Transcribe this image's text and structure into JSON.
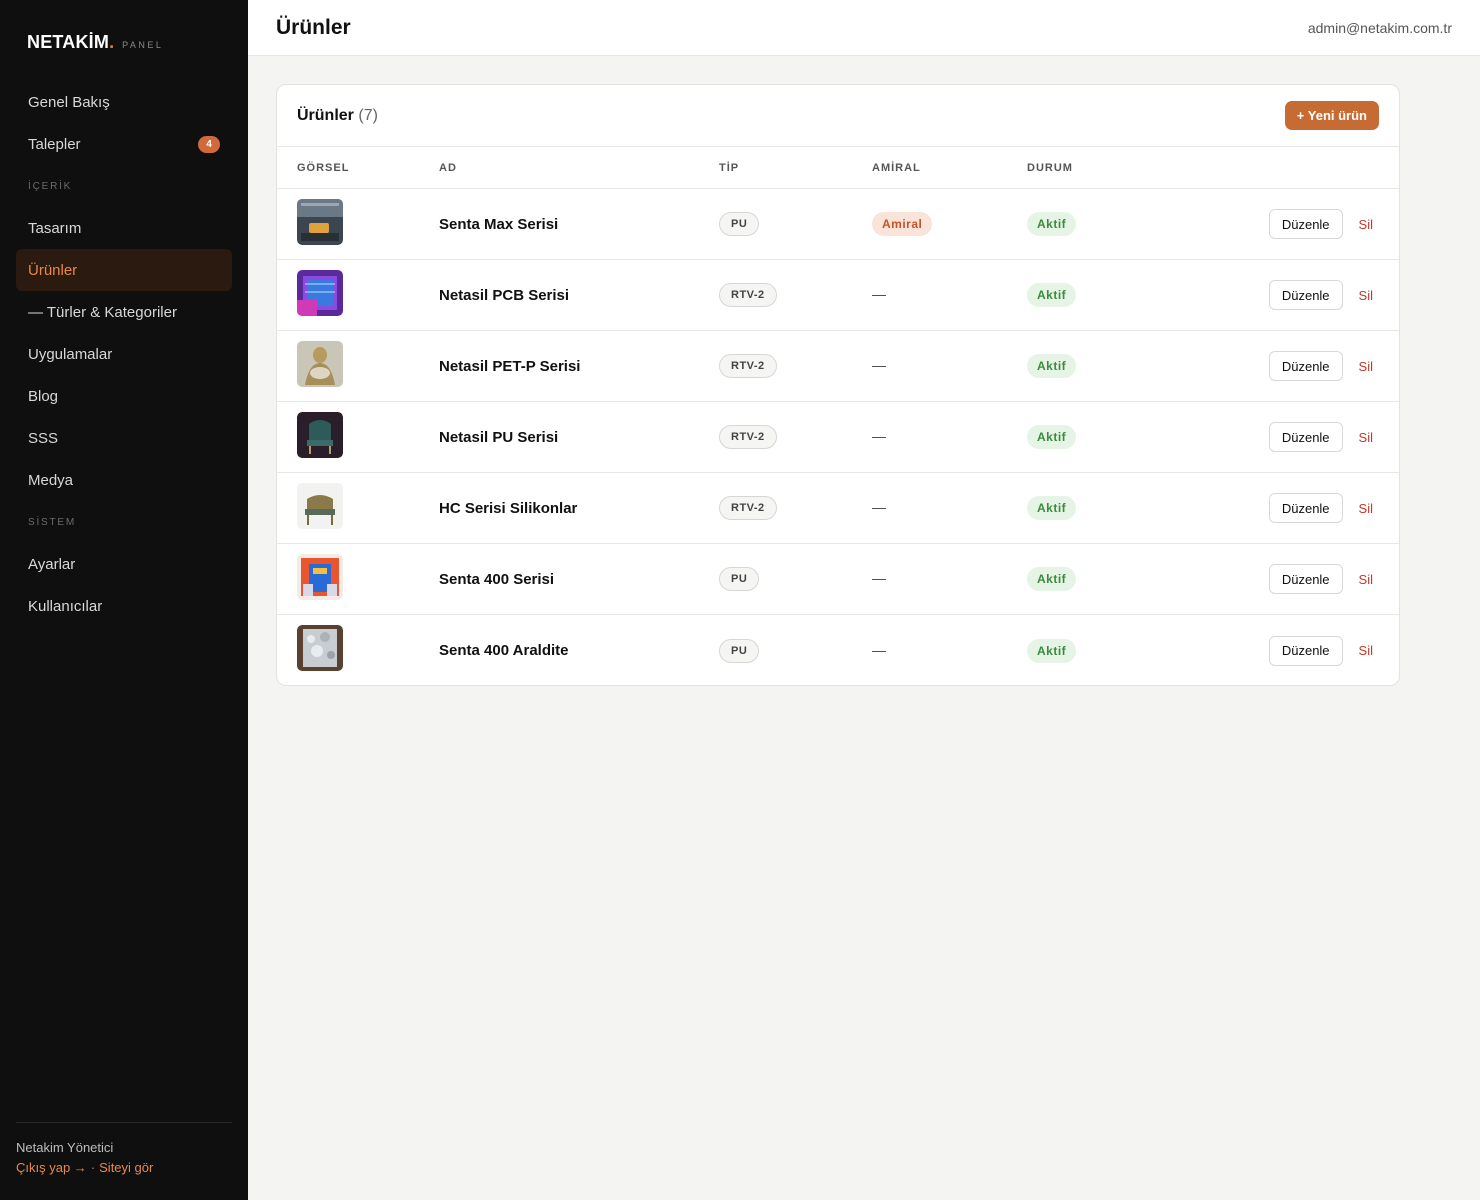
{
  "brand": {
    "name": "NETAKİM",
    "dot": ".",
    "panel": "PANEL"
  },
  "nav": {
    "genel": "Genel Bakış",
    "talepler": "Talepler",
    "talepler_badge": "4",
    "section_icerik": "İÇERİK",
    "tasarim": "Tasarım",
    "urunler": "Ürünler",
    "turler": "— Türler & Kategoriler",
    "uygulamalar": "Uygulamalar",
    "blog": "Blog",
    "sss": "SSS",
    "medya": "Medya",
    "section_sistem": "SİSTEM",
    "ayarlar": "Ayarlar",
    "kullanicilar": "Kullanıcılar"
  },
  "footer": {
    "user": "Netakim Yönetici",
    "logout": "Çıkış yap →",
    "separator": "·",
    "site": "Siteyi gör"
  },
  "header": {
    "title": "Ürünler",
    "email": "admin@netakim.com.tr"
  },
  "card": {
    "title": "Ürünler",
    "count": "(7)",
    "new_button": "+ Yeni ürün"
  },
  "columns": {
    "image": "GÖRSEL",
    "name": "AD",
    "type": "TİP",
    "flag": "AMİRAL",
    "status": "DURUM"
  },
  "actions": {
    "edit": "Düzenle",
    "delete": "Sil"
  },
  "products": [
    {
      "name": "Senta Max Serisi",
      "type": "PU",
      "flag": "Amiral",
      "status": "Aktif"
    },
    {
      "name": "Netasil PCB Serisi",
      "type": "RTV-2",
      "flag": "—",
      "status": "Aktif"
    },
    {
      "name": "Netasil PET-P Serisi",
      "type": "RTV-2",
      "flag": "—",
      "status": "Aktif"
    },
    {
      "name": "Netasil PU Serisi",
      "type": "RTV-2",
      "flag": "—",
      "status": "Aktif"
    },
    {
      "name": "HC Serisi Silikonlar",
      "type": "RTV-2",
      "flag": "—",
      "status": "Aktif"
    },
    {
      "name": "Senta 400 Serisi",
      "type": "PU",
      "flag": "—",
      "status": "Aktif"
    },
    {
      "name": "Senta 400 Araldite",
      "type": "PU",
      "flag": "—",
      "status": "Aktif"
    }
  ],
  "colors": {
    "accent": "#c76b34",
    "sidebar_bg": "#0f0f10",
    "active_text": "#e8894a",
    "success": "#3d8a3d",
    "danger": "#c0392b"
  }
}
